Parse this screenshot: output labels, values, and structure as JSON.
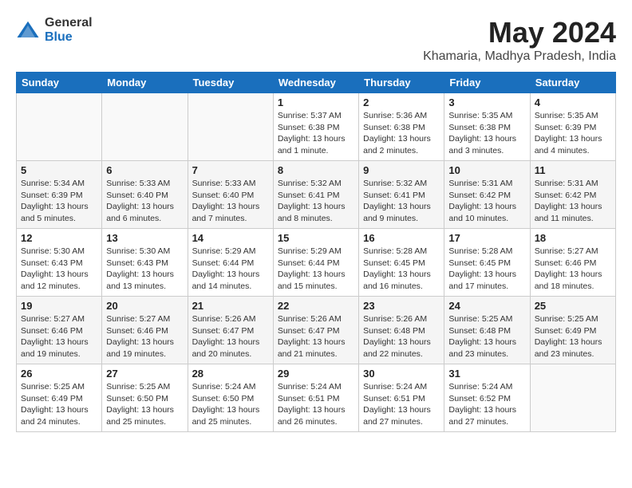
{
  "header": {
    "logo_general": "General",
    "logo_blue": "Blue",
    "month_year": "May 2024",
    "location": "Khamaria, Madhya Pradesh, India"
  },
  "days_of_week": [
    "Sunday",
    "Monday",
    "Tuesday",
    "Wednesday",
    "Thursday",
    "Friday",
    "Saturday"
  ],
  "weeks": [
    [
      {
        "day": "",
        "info": ""
      },
      {
        "day": "",
        "info": ""
      },
      {
        "day": "",
        "info": ""
      },
      {
        "day": "1",
        "info": "Sunrise: 5:37 AM\nSunset: 6:38 PM\nDaylight: 13 hours\nand 1 minute."
      },
      {
        "day": "2",
        "info": "Sunrise: 5:36 AM\nSunset: 6:38 PM\nDaylight: 13 hours\nand 2 minutes."
      },
      {
        "day": "3",
        "info": "Sunrise: 5:35 AM\nSunset: 6:38 PM\nDaylight: 13 hours\nand 3 minutes."
      },
      {
        "day": "4",
        "info": "Sunrise: 5:35 AM\nSunset: 6:39 PM\nDaylight: 13 hours\nand 4 minutes."
      }
    ],
    [
      {
        "day": "5",
        "info": "Sunrise: 5:34 AM\nSunset: 6:39 PM\nDaylight: 13 hours\nand 5 minutes."
      },
      {
        "day": "6",
        "info": "Sunrise: 5:33 AM\nSunset: 6:40 PM\nDaylight: 13 hours\nand 6 minutes."
      },
      {
        "day": "7",
        "info": "Sunrise: 5:33 AM\nSunset: 6:40 PM\nDaylight: 13 hours\nand 7 minutes."
      },
      {
        "day": "8",
        "info": "Sunrise: 5:32 AM\nSunset: 6:41 PM\nDaylight: 13 hours\nand 8 minutes."
      },
      {
        "day": "9",
        "info": "Sunrise: 5:32 AM\nSunset: 6:41 PM\nDaylight: 13 hours\nand 9 minutes."
      },
      {
        "day": "10",
        "info": "Sunrise: 5:31 AM\nSunset: 6:42 PM\nDaylight: 13 hours\nand 10 minutes."
      },
      {
        "day": "11",
        "info": "Sunrise: 5:31 AM\nSunset: 6:42 PM\nDaylight: 13 hours\nand 11 minutes."
      }
    ],
    [
      {
        "day": "12",
        "info": "Sunrise: 5:30 AM\nSunset: 6:43 PM\nDaylight: 13 hours\nand 12 minutes."
      },
      {
        "day": "13",
        "info": "Sunrise: 5:30 AM\nSunset: 6:43 PM\nDaylight: 13 hours\nand 13 minutes."
      },
      {
        "day": "14",
        "info": "Sunrise: 5:29 AM\nSunset: 6:44 PM\nDaylight: 13 hours\nand 14 minutes."
      },
      {
        "day": "15",
        "info": "Sunrise: 5:29 AM\nSunset: 6:44 PM\nDaylight: 13 hours\nand 15 minutes."
      },
      {
        "day": "16",
        "info": "Sunrise: 5:28 AM\nSunset: 6:45 PM\nDaylight: 13 hours\nand 16 minutes."
      },
      {
        "day": "17",
        "info": "Sunrise: 5:28 AM\nSunset: 6:45 PM\nDaylight: 13 hours\nand 17 minutes."
      },
      {
        "day": "18",
        "info": "Sunrise: 5:27 AM\nSunset: 6:46 PM\nDaylight: 13 hours\nand 18 minutes."
      }
    ],
    [
      {
        "day": "19",
        "info": "Sunrise: 5:27 AM\nSunset: 6:46 PM\nDaylight: 13 hours\nand 19 minutes."
      },
      {
        "day": "20",
        "info": "Sunrise: 5:27 AM\nSunset: 6:46 PM\nDaylight: 13 hours\nand 19 minutes."
      },
      {
        "day": "21",
        "info": "Sunrise: 5:26 AM\nSunset: 6:47 PM\nDaylight: 13 hours\nand 20 minutes."
      },
      {
        "day": "22",
        "info": "Sunrise: 5:26 AM\nSunset: 6:47 PM\nDaylight: 13 hours\nand 21 minutes."
      },
      {
        "day": "23",
        "info": "Sunrise: 5:26 AM\nSunset: 6:48 PM\nDaylight: 13 hours\nand 22 minutes."
      },
      {
        "day": "24",
        "info": "Sunrise: 5:25 AM\nSunset: 6:48 PM\nDaylight: 13 hours\nand 23 minutes."
      },
      {
        "day": "25",
        "info": "Sunrise: 5:25 AM\nSunset: 6:49 PM\nDaylight: 13 hours\nand 23 minutes."
      }
    ],
    [
      {
        "day": "26",
        "info": "Sunrise: 5:25 AM\nSunset: 6:49 PM\nDaylight: 13 hours\nand 24 minutes."
      },
      {
        "day": "27",
        "info": "Sunrise: 5:25 AM\nSunset: 6:50 PM\nDaylight: 13 hours\nand 25 minutes."
      },
      {
        "day": "28",
        "info": "Sunrise: 5:24 AM\nSunset: 6:50 PM\nDaylight: 13 hours\nand 25 minutes."
      },
      {
        "day": "29",
        "info": "Sunrise: 5:24 AM\nSunset: 6:51 PM\nDaylight: 13 hours\nand 26 minutes."
      },
      {
        "day": "30",
        "info": "Sunrise: 5:24 AM\nSunset: 6:51 PM\nDaylight: 13 hours\nand 27 minutes."
      },
      {
        "day": "31",
        "info": "Sunrise: 5:24 AM\nSunset: 6:52 PM\nDaylight: 13 hours\nand 27 minutes."
      },
      {
        "day": "",
        "info": ""
      }
    ]
  ]
}
